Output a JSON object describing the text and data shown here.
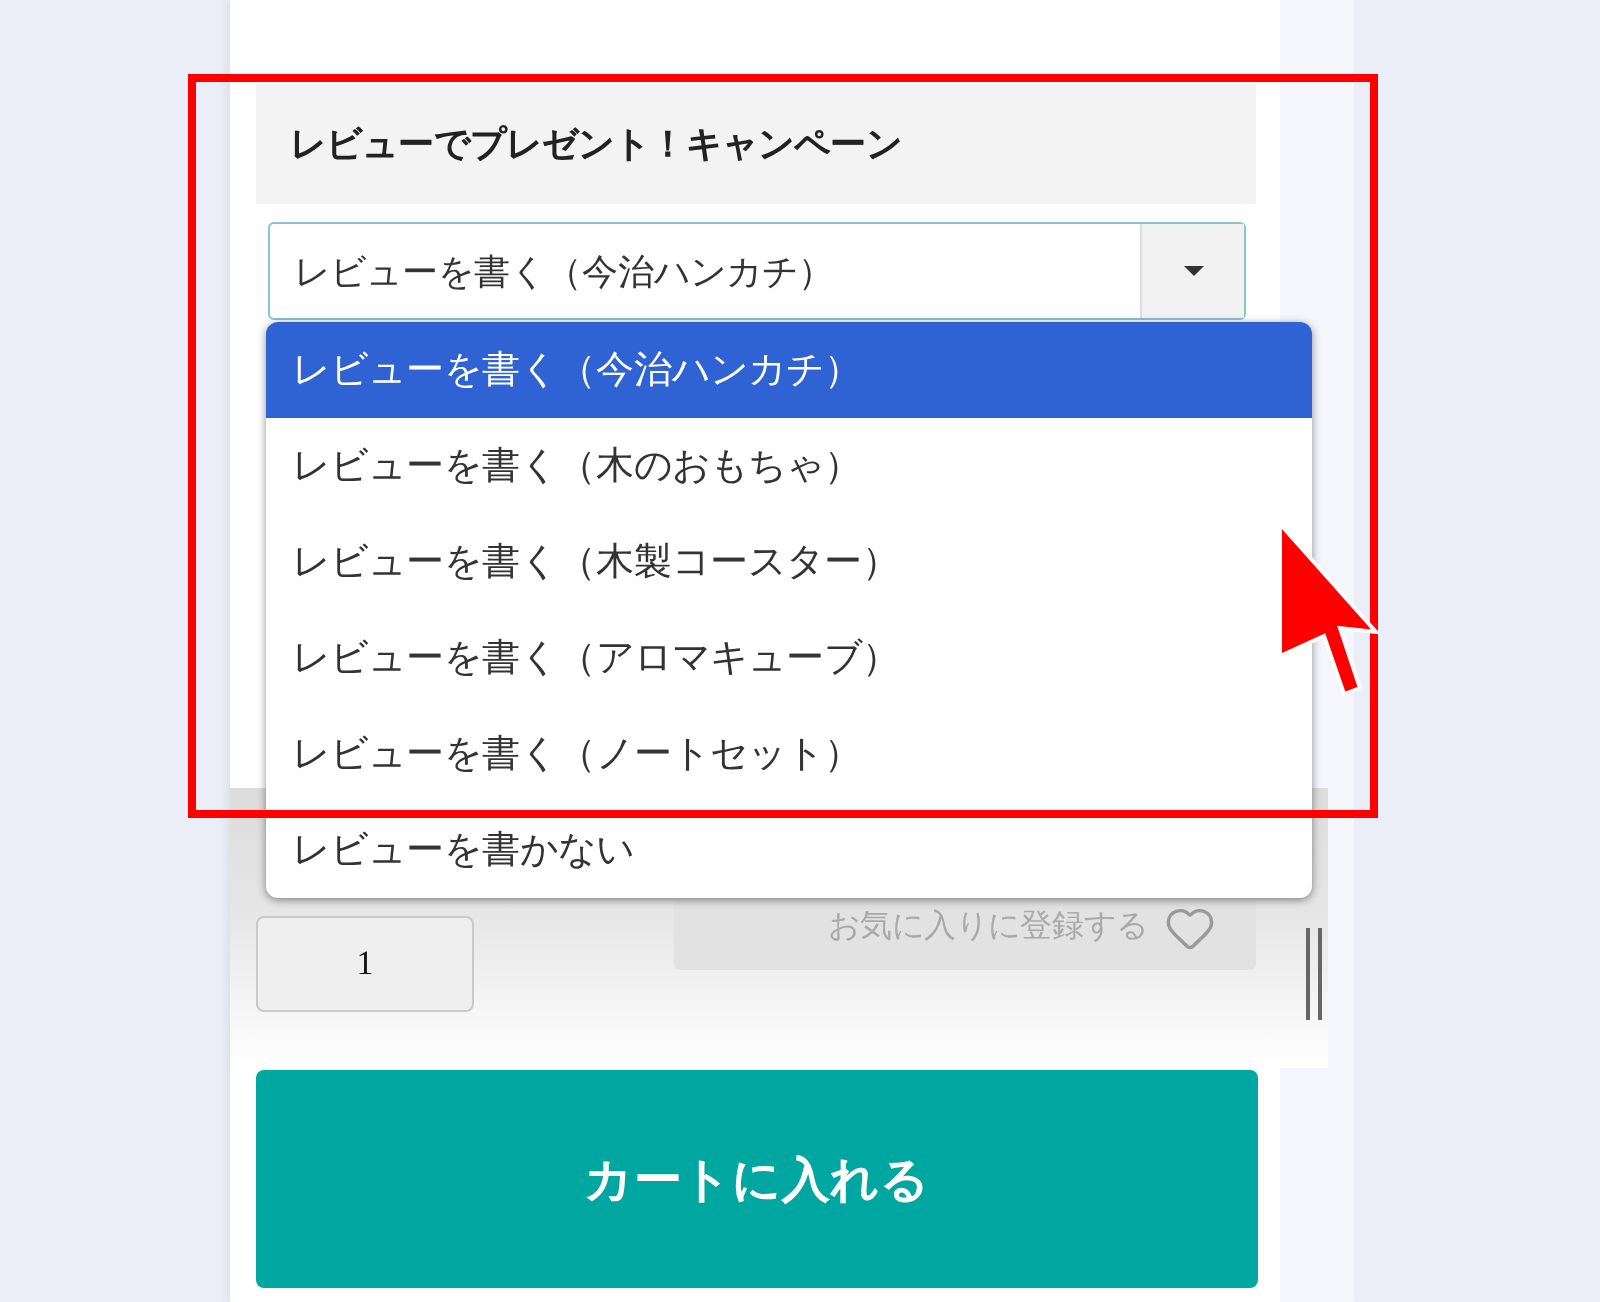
{
  "campaign": {
    "title": "レビューでプレゼント！キャンペーン",
    "select": {
      "value": "レビューを書く（今治ハンカチ）",
      "expanded": true
    },
    "options": [
      {
        "label": "レビューを書く（今治ハンカチ）",
        "selected": true
      },
      {
        "label": "レビューを書く（木のおもちゃ）",
        "selected": false
      },
      {
        "label": "レビューを書く（木製コースター）",
        "selected": false
      },
      {
        "label": "レビューを書く（アロマキューブ）",
        "selected": false
      },
      {
        "label": "レビューを書く（ノートセット）",
        "selected": false
      },
      {
        "label": "レビューを書かない",
        "selected": false
      }
    ]
  },
  "quantity": {
    "value": "1"
  },
  "favorite_button": {
    "label": "お気に入りに登録する"
  },
  "cart_button": {
    "label": "カートに入れる"
  }
}
